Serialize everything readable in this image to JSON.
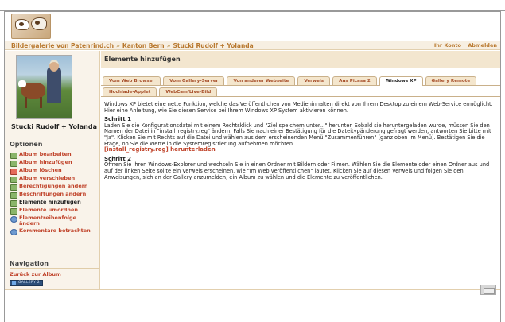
{
  "header": {
    "logo": "patenrind-logo"
  },
  "breadcrumbs": [
    "Bildergalerie von Patenrind.ch",
    "Kanton Bern",
    "Stucki Rudolf + Yolanda"
  ],
  "breadcrumb_separator": "»",
  "user_links": {
    "account": "Ihr Konto",
    "logout": "Abmelden"
  },
  "sidebar": {
    "album_name": "Stucki Rudolf + Yolanda",
    "options_title": "Optionen",
    "options": [
      {
        "label": "Album bearbeiten",
        "icon": "edit-icon"
      },
      {
        "label": "Album hinzufügen",
        "icon": "add-icon"
      },
      {
        "label": "Album löschen",
        "icon": "delete-icon"
      },
      {
        "label": "Album verschieben",
        "icon": "move-icon"
      },
      {
        "label": "Berechtigungen ändern",
        "icon": "permissions-icon"
      },
      {
        "label": "Beschriftungen ändern",
        "icon": "captions-icon"
      },
      {
        "label": "Elemente hinzufügen",
        "icon": "add-items-icon"
      },
      {
        "label": "Elemente umordnen",
        "icon": "reorder-icon"
      },
      {
        "label": "Elementreihenfolge ändern",
        "icon": "sort-icon"
      },
      {
        "label": "Kommentare betrachten",
        "icon": "comments-icon"
      }
    ],
    "navigation_title": "Navigation",
    "navigation_link": "Zurück zur Album",
    "badge": "GALLERY 2"
  },
  "main": {
    "title": "Elemente hinzufügen",
    "tabs_row1": [
      "Vom Web Browser",
      "Vom Gallery-Server",
      "Von anderer Webseite",
      "Verweis",
      "Aus Picasa 2",
      "Windows XP",
      "Gallery Remote"
    ],
    "tabs_row2": [
      "Hochlade-Applet",
      "WebCam/Live-Bild"
    ],
    "active_tab": "Windows XP",
    "intro": "Windows XP bietet eine nette Funktion, welche das Veröffentlichen von Medieninhalten direkt von Ihrem Desktop zu einem Web-Service ermöglicht. Hier eine Anleitung, wie Sie diesen Service bei Ihrem Windows XP System aktivieren können.",
    "step1_title": "Schritt 1",
    "step1_text": "Laden Sie die Konfigurationsdatei mit einem Rechtsklick und \"Ziel speichern unter...\" herunter. Sobald sie heruntergeladen wurde, müssen Sie den Namen der Datei in \"install_registry.reg\" ändern. Falls Sie nach einer Bestätigung für die Dateitypänderung gefragt werden, antworten Sie bitte mit \"Ja\". Klicken Sie mit Rechts auf die Datei und wählen aus dem erscheinenden Menü \"Zusammenführen\" (ganz oben im Menü). Bestätigen Sie die Frage, ob Sie die Werte in die Systemregistrierung aufnehmen möchten.",
    "step1_link": "[install_registry.reg] herunterladen",
    "step2_title": "Schritt 2",
    "step2_text": "Öffnen Sie Ihren Windows-Explorer und wechseln Sie in einen Ordner mit Bildern oder Filmen. Wählen Sie die Elemente oder einen Ordner aus und auf der linken Seite sollte ein Verweis erscheinen, wie \"Im Web veröffentlichen\" lautet. Klicken Sie auf diesen Verweis und folgen Sie den Anweisungen, sich an der Gallery anzumelden, ein Album zu wählen und die Elemente zu veröffentlichen."
  },
  "colors": {
    "accent": "#c0432a",
    "crumb": "#b8782e",
    "panel": "#f9f3ea"
  }
}
